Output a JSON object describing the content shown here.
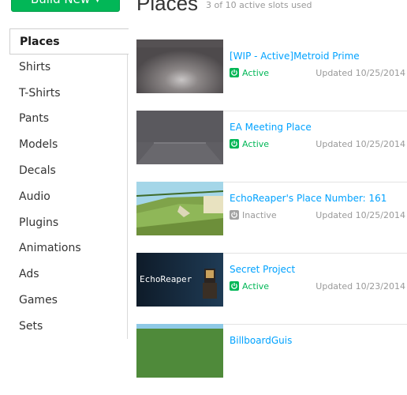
{
  "build_button": {
    "label": "Build New"
  },
  "header": {
    "title": "Places",
    "slots": "3 of 10 active slots used"
  },
  "sidebar": {
    "items": [
      {
        "label": "Places",
        "active": true
      },
      {
        "label": "Shirts"
      },
      {
        "label": "T-Shirts"
      },
      {
        "label": "Pants"
      },
      {
        "label": "Models"
      },
      {
        "label": "Decals"
      },
      {
        "label": "Audio"
      },
      {
        "label": "Plugins"
      },
      {
        "label": "Animations"
      },
      {
        "label": "Ads"
      },
      {
        "label": "Games"
      },
      {
        "label": "Sets"
      }
    ]
  },
  "places": [
    {
      "name": "[WIP - Active]Metroid Prime",
      "status": "Active",
      "updated": "Updated 10/25/2014"
    },
    {
      "name": "EA Meeting Place",
      "status": "Active",
      "updated": "Updated 10/25/2014"
    },
    {
      "name": "EchoReaper's Place Number: 161",
      "status": "Inactive",
      "updated": "Updated 10/25/2014"
    },
    {
      "name": "Secret Project",
      "status": "Active",
      "updated": "Updated 10/23/2014",
      "thumb_text": "EchoReaper"
    },
    {
      "name": "BillboardGuis",
      "status": "",
      "updated": ""
    }
  ],
  "colors": {
    "accent_green": "#02b757",
    "link_blue": "#00a2ff",
    "muted_gray": "#999999"
  }
}
